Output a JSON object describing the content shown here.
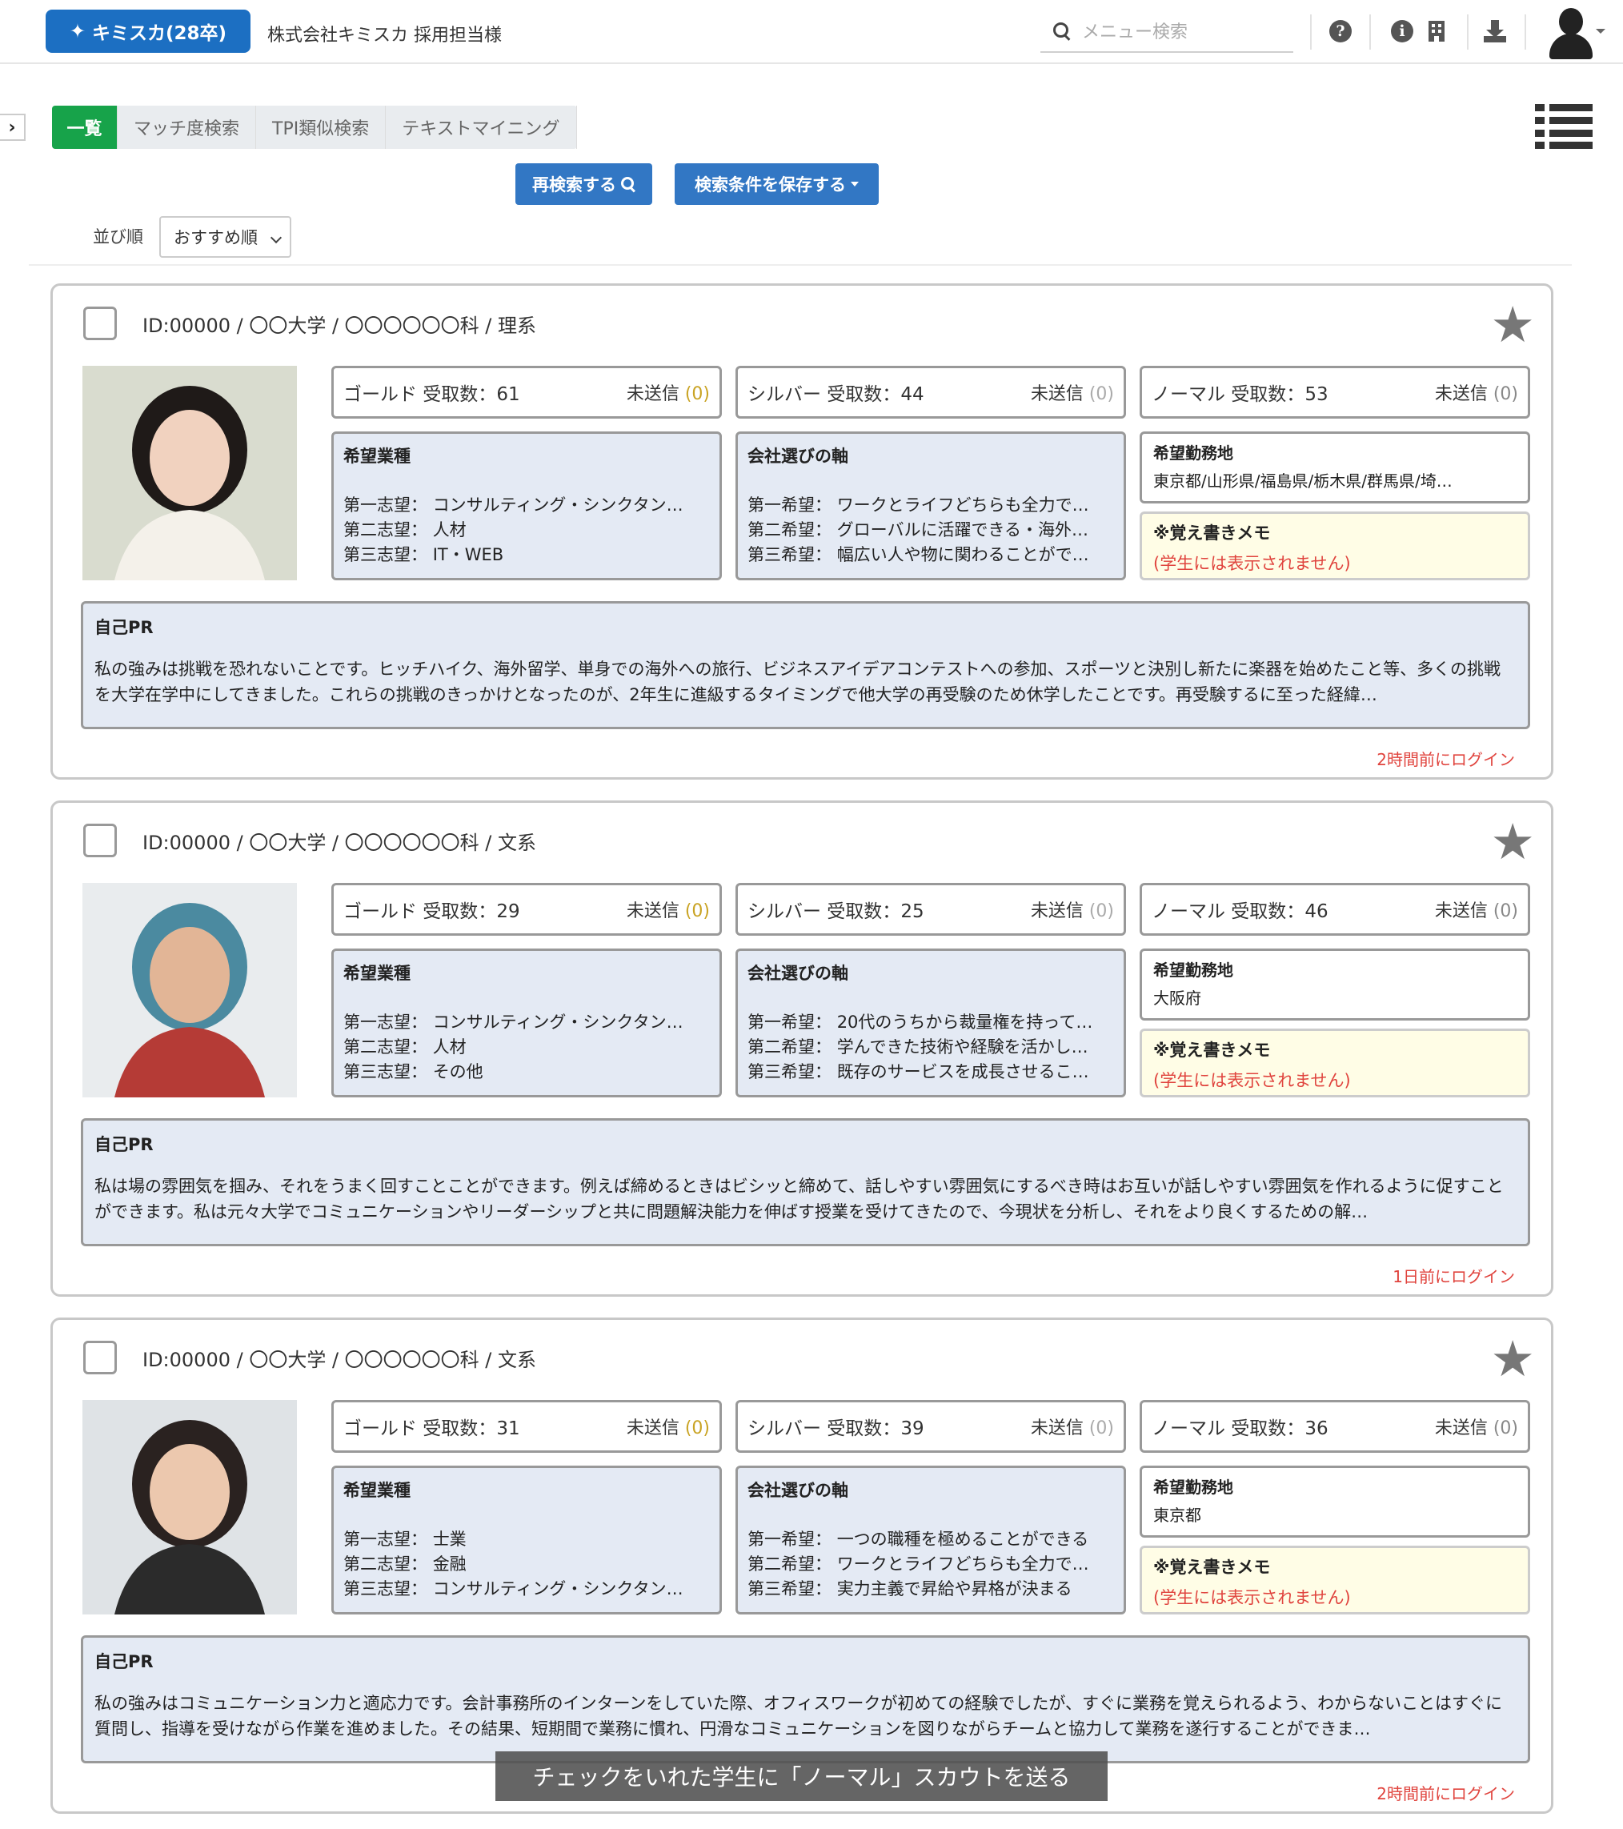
{
  "header": {
    "brand_label": "キミスカ(28卒)",
    "company": "株式会社キミスカ 採用担当様",
    "search_placeholder": "メニュー検索",
    "icons": [
      "question-icon",
      "info-icon",
      "building-icon",
      "download-icon",
      "user-icon"
    ]
  },
  "tabs": [
    {
      "label": "一覧",
      "active": true
    },
    {
      "label": "マッチ度検索",
      "active": false
    },
    {
      "label": "TPI類似検索",
      "active": false
    },
    {
      "label": "テキストマイニング",
      "active": false
    }
  ],
  "toolbar": {
    "research_label": "再検索する",
    "save_label": "検索条件を保存する",
    "sort_label": "並び順",
    "sort_value": "おすすめ順"
  },
  "labels": {
    "gold": "ゴールド 受取数：",
    "silver": "シルバー 受取数：",
    "normal": "ノーマル 受取数：",
    "unsent": "未送信",
    "industry_title": "希望業種",
    "axis_title": "会社選びの軸",
    "location_title": "希望勤務地",
    "memo_title": "※覚え書きメモ",
    "memo_note": "(学生には表示されません)",
    "pr_title": "自己PR",
    "choice1": "第一志望：",
    "choice2": "第二志望：",
    "choice3": "第三志望：",
    "hope1": "第一希望：",
    "hope2": "第二希望：",
    "hope3": "第三希望："
  },
  "students": [
    {
      "title": "ID:00000 / 〇〇大学 / 〇〇〇〇〇〇科 / 理系",
      "gold_count": "61",
      "gold_unsent": "(0)",
      "silver_count": "44",
      "silver_unsent": "(0)",
      "normal_count": "53",
      "normal_unsent": "(0)",
      "industry": [
        "コンサルティング・シンクタン…",
        "人材",
        "IT・WEB"
      ],
      "axis": [
        "ワークとライフどちらも全力で…",
        "グローバルに活躍できる・海外…",
        "幅広い人や物に関わることがで…"
      ],
      "location": "東京都/山形県/福島県/栃木県/群馬県/埼…",
      "pr": "私の強みは挑戦を恐れないことです。ヒッチハイク、海外留学、単身での海外への旅行、ビジネスアイデアコンテストへの参加、スポーツと決別し新たに楽器を始めたこと等、多くの挑戦を大学在学中にしてきました。これらの挑戦のきっかけとなったのが、2年生に進級するタイミングで他大学の再受験のため休学したことです。再受験するに至った経緯…",
      "login": "2時間前にログイン"
    },
    {
      "title": "ID:00000 / 〇〇大学 / 〇〇〇〇〇〇科 / 文系",
      "gold_count": "29",
      "gold_unsent": "(0)",
      "silver_count": "25",
      "silver_unsent": "(0)",
      "normal_count": "46",
      "normal_unsent": "(0)",
      "industry": [
        "コンサルティング・シンクタン…",
        "人材",
        "その他"
      ],
      "axis": [
        "20代のうちから裁量権を持って…",
        "学んできた技術や経験を活かし…",
        "既存のサービスを成長させるこ…"
      ],
      "location": "大阪府",
      "pr": "私は場の雰囲気を掴み、それをうまく回すことことができます。例えば締めるときはビシッと締めて、話しやすい雰囲気にするべき時はお互いが話しやすい雰囲気を作れるように促すことができます。私は元々大学でコミュニケーションやリーダーシップと共に問題解決能力を伸ばす授業を受けてきたので、今現状を分析し、それをより良くするための解…",
      "login": "1日前にログイン"
    },
    {
      "title": "ID:00000 / 〇〇大学 / 〇〇〇〇〇〇科 / 文系",
      "gold_count": "31",
      "gold_unsent": "(0)",
      "silver_count": "39",
      "silver_unsent": "(0)",
      "normal_count": "36",
      "normal_unsent": "(0)",
      "industry": [
        "士業",
        "金融",
        "コンサルティング・シンクタン…"
      ],
      "axis": [
        "一つの職種を極めることができる",
        "ワークとライフどちらも全力で…",
        "実力主義で昇給や昇格が決まる"
      ],
      "location": "東京都",
      "pr": "私の強みはコミュニケーション力と適応力です。会計事務所のインターンをしていた際、オフィスワークが初めての経験でしたが、すぐに業務を覚えられるよう、わからないことはすぐに質問し、指導を受けながら作業を進めました。その結果、短期間で業務に慣れ、円滑なコミュニケーションを図りながらチームと協力して業務を遂行することができま…",
      "login": "2時間前にログイン"
    }
  ],
  "scout_button": "チェックをいれた学生に「ノーマル」スカウトを送る"
}
